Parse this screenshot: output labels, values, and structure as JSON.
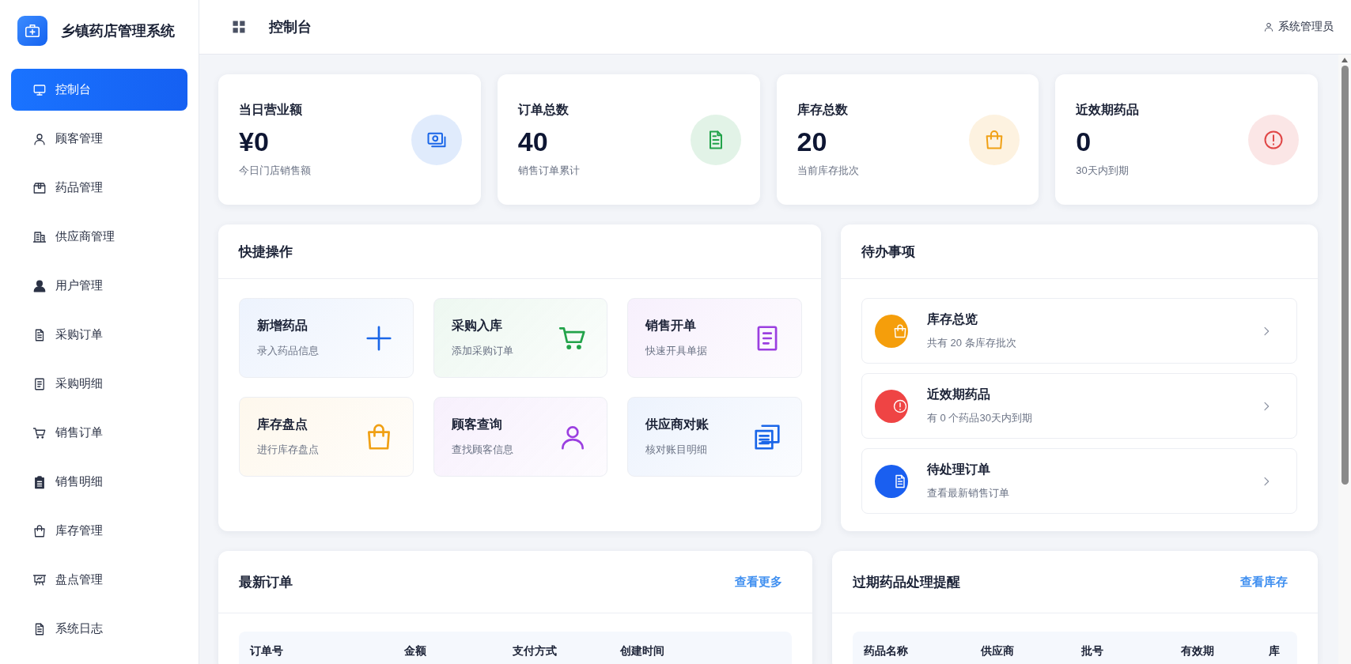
{
  "app": {
    "title": "乡镇药店管理系统"
  },
  "sidebar": {
    "items": [
      {
        "label": "控制台",
        "selected": true
      },
      {
        "label": "顾客管理",
        "selected": false
      },
      {
        "label": "药品管理",
        "selected": false
      },
      {
        "label": "供应商管理",
        "selected": false
      },
      {
        "label": "用户管理",
        "selected": false
      },
      {
        "label": "采购订单",
        "selected": false
      },
      {
        "label": "采购明细",
        "selected": false
      },
      {
        "label": "销售订单",
        "selected": false
      },
      {
        "label": "销售明细",
        "selected": false
      },
      {
        "label": "库存管理",
        "selected": false
      },
      {
        "label": "盘点管理",
        "selected": false
      },
      {
        "label": "系统日志",
        "selected": false
      }
    ]
  },
  "header": {
    "title": "控制台",
    "user": "系统管理员"
  },
  "stats": [
    {
      "title": "当日营业额",
      "value": "¥0",
      "caption": "今日门店销售额",
      "color": "#1a66e8"
    },
    {
      "title": "订单总数",
      "value": "40",
      "caption": "销售订单累计",
      "color": "#22a34a"
    },
    {
      "title": "库存总数",
      "value": "20",
      "caption": "当前库存批次",
      "color": "#f0a014"
    },
    {
      "title": "近效期药品",
      "value": "0",
      "caption": "30天内到期",
      "color": "#e04646"
    }
  ],
  "quick_actions": {
    "title": "快捷操作",
    "items": [
      {
        "title": "新增药品",
        "caption": "录入药品信息",
        "color": "#1a66e8"
      },
      {
        "title": "采购入库",
        "caption": "添加采购订单",
        "color": "#22a34a"
      },
      {
        "title": "销售开单",
        "caption": "快速开具单据",
        "color": "#9b3fe0"
      },
      {
        "title": "库存盘点",
        "caption": "进行库存盘点",
        "color": "#f0a014"
      },
      {
        "title": "顾客查询",
        "caption": "查找顾客信息",
        "color": "#9b3fe0"
      },
      {
        "title": "供应商对账",
        "caption": "核对账目明细",
        "color": "#1a66e8"
      }
    ]
  },
  "todo": {
    "title": "待办事项",
    "items": [
      {
        "title": "库存总览",
        "caption": "共有 20 条库存批次",
        "color": "#f59e0b"
      },
      {
        "title": "近效期药品",
        "caption": "有 0 个药品30天内到期",
        "color": "#ef4444"
      },
      {
        "title": "待处理订单",
        "caption": "查看最新销售订单",
        "color": "#1a5ff0"
      }
    ]
  },
  "recent_orders": {
    "title": "最新订单",
    "link": "查看更多",
    "columns": [
      "订单号",
      "金额",
      "支付方式",
      "创建时间"
    ]
  },
  "expiry_reminders": {
    "title": "过期药品处理提醒",
    "link": "查看库存",
    "columns": [
      "药品名称",
      "供应商",
      "批号",
      "有效期",
      "库"
    ]
  }
}
